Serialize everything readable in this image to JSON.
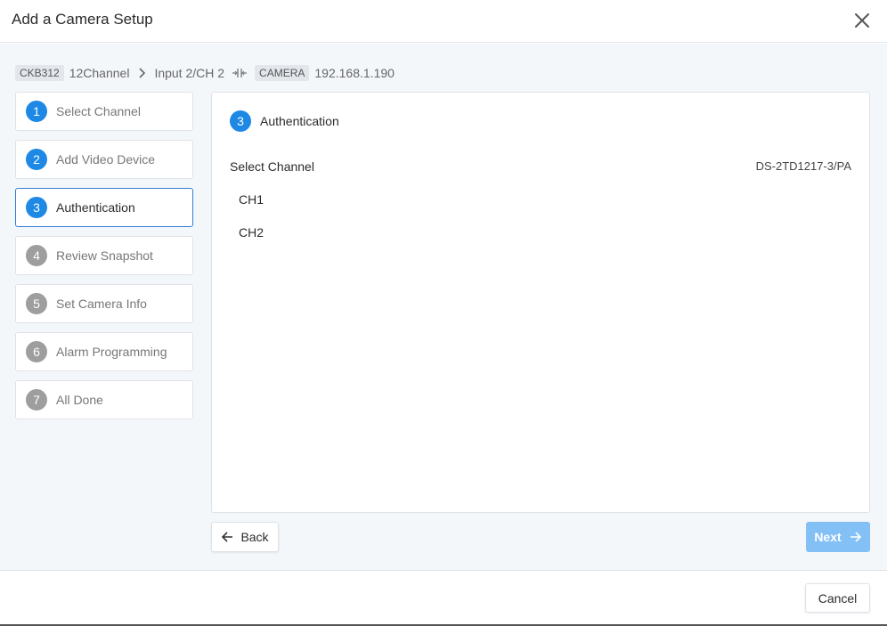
{
  "dialog": {
    "title": "Add a Camera Setup",
    "close_icon": "close-icon"
  },
  "breadcrumb": {
    "device_tag": "CKB312",
    "device_name": "12Channel",
    "input": "Input 2/CH 2",
    "camera_tag": "CAMERA",
    "camera_ip": "192.168.1.190"
  },
  "steps": [
    {
      "num": "1",
      "label": "Select Channel",
      "state": "done"
    },
    {
      "num": "2",
      "label": "Add Video Device",
      "state": "done"
    },
    {
      "num": "3",
      "label": "Authentication",
      "state": "active"
    },
    {
      "num": "4",
      "label": "Review Snapshot",
      "state": "pending"
    },
    {
      "num": "5",
      "label": "Set Camera Info",
      "state": "pending"
    },
    {
      "num": "6",
      "label": "Alarm Programming",
      "state": "pending"
    },
    {
      "num": "7",
      "label": "All Done",
      "state": "pending"
    }
  ],
  "panel": {
    "step_num": "3",
    "title": "Authentication",
    "section_label": "Select Channel",
    "model": "DS-2TD1217-3/PA",
    "channels": [
      "CH1",
      "CH2"
    ]
  },
  "buttons": {
    "back": "Back",
    "next": "Next",
    "cancel": "Cancel"
  },
  "colors": {
    "accent": "#1e88e5",
    "pending": "#9e9e9e",
    "next_disabled": "#82c0f6",
    "background": "#f4f7fa"
  }
}
